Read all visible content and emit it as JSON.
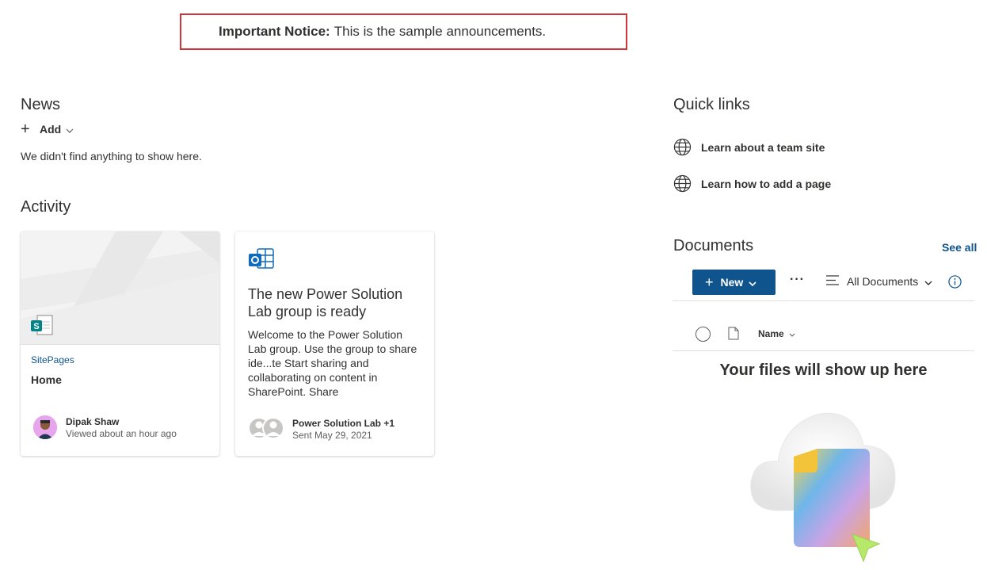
{
  "announcement": {
    "label": "Important Notice:",
    "text": "This is the sample announcements."
  },
  "news": {
    "title": "News",
    "add_label": "Add",
    "empty_text": "We didn't find anything to show here."
  },
  "activity": {
    "title": "Activity",
    "cards": [
      {
        "kicker": "SitePages",
        "title": "Home",
        "person": "Dipak Shaw",
        "meta": "Viewed about an hour ago",
        "icon": "sharepoint-page-icon"
      },
      {
        "title": "The new Power Solution Lab group is ready",
        "body": "Welcome to the Power Solution Lab group. Use the group to share ide...te Start sharing and collaborating on content in SharePoint. Share",
        "person": "Power Solution Lab +1",
        "meta": "Sent May 29, 2021",
        "icon": "outlook-icon"
      }
    ]
  },
  "quick_links": {
    "title": "Quick links",
    "items": [
      {
        "label": "Learn about a team site",
        "icon": "globe-icon"
      },
      {
        "label": "Learn how to add a page",
        "icon": "globe-icon"
      }
    ]
  },
  "documents": {
    "title": "Documents",
    "see_all": "See all",
    "new_label": "New",
    "more_label": "···",
    "view_label": "All Documents",
    "column_name": "Name",
    "empty_text": "Your files will show up here"
  },
  "colors": {
    "accent": "#0f548c",
    "notice_border": "#d13438",
    "text": "#323130"
  }
}
